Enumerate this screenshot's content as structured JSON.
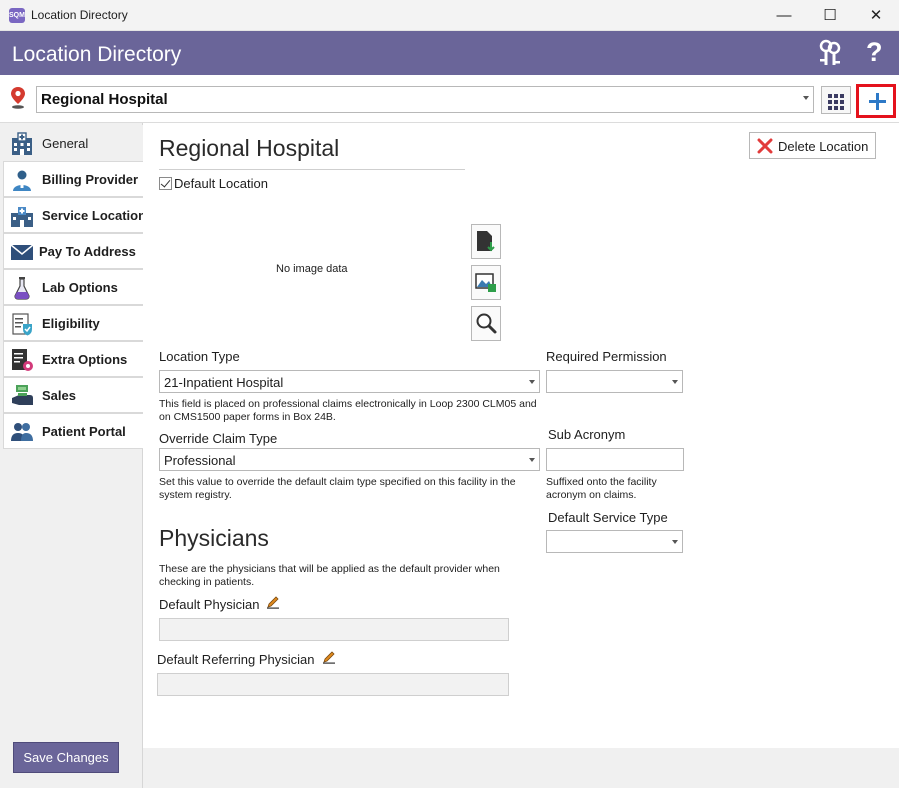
{
  "window": {
    "app_icon_text": "SQM",
    "title": "Location Directory",
    "minimize_glyph": "—",
    "maximize_glyph": "☐",
    "close_glyph": "✕"
  },
  "header": {
    "title": "Location Directory",
    "help_glyph": "?",
    "icons": [
      "keys-icon",
      "help-icon"
    ]
  },
  "location_bar": {
    "selected_location": "Regional Hospital",
    "icons": [
      "map-pin-icon",
      "grid-icon",
      "plus-icon"
    ]
  },
  "sidebar": {
    "items": [
      {
        "label": "General",
        "icon": "hospital-building-icon",
        "active": true
      },
      {
        "label": "Billing Provider",
        "icon": "provider-icon",
        "active": false
      },
      {
        "label": "Service Location",
        "icon": "service-building-icon",
        "active": false
      },
      {
        "label": "Pay To Address",
        "icon": "envelope-icon",
        "active": false
      },
      {
        "label": "Lab Options",
        "icon": "flask-icon",
        "active": false
      },
      {
        "label": "Eligibility",
        "icon": "checklist-shield-icon",
        "active": false
      },
      {
        "label": "Extra Options",
        "icon": "document-gear-icon",
        "active": false
      },
      {
        "label": "Sales",
        "icon": "money-bag-icon",
        "active": false
      },
      {
        "label": "Patient Portal",
        "icon": "users-icon",
        "active": false
      }
    ],
    "save_label": "Save Changes"
  },
  "general": {
    "location_name": "Regional Hospital",
    "delete_label": "Delete Location",
    "default_location_label": "Default Location",
    "default_location_checked": true,
    "no_image_text": "No image data",
    "image_tools": [
      "file-import-icon",
      "image-save-icon",
      "magnifier-icon"
    ],
    "location_type": {
      "label": "Location Type",
      "value": "21-Inpatient Hospital",
      "hint": "This field is placed on professional claims electronically in Loop 2300 CLM05 and on CMS1500 paper forms in Box 24B."
    },
    "required_permission": {
      "label": "Required Permission",
      "value": ""
    },
    "override_claim_type": {
      "label": "Override Claim Type",
      "value": "Professional",
      "hint": "Set this value to override the default claim type specified on this facility in the system registry."
    },
    "sub_acronym": {
      "label": "Sub Acronym",
      "value": "",
      "hint": "Suffixed onto the facility acronym on claims."
    },
    "default_service_type": {
      "label": "Default Service Type",
      "value": ""
    }
  },
  "physicians": {
    "title": "Physicians",
    "description": "These are the physicians that will be applied as the default provider when checking in patients.",
    "default_physician_label": "Default Physician",
    "default_physician_value": "",
    "default_referring_label": "Default Referring Physician",
    "default_referring_value": ""
  },
  "colors": {
    "header_bg": "#6a6599",
    "add_button_highlight": "#e4121c",
    "plus_icon": "#2d79c7",
    "delete_x": "#e23b3b",
    "pin": "#d43a2f"
  }
}
